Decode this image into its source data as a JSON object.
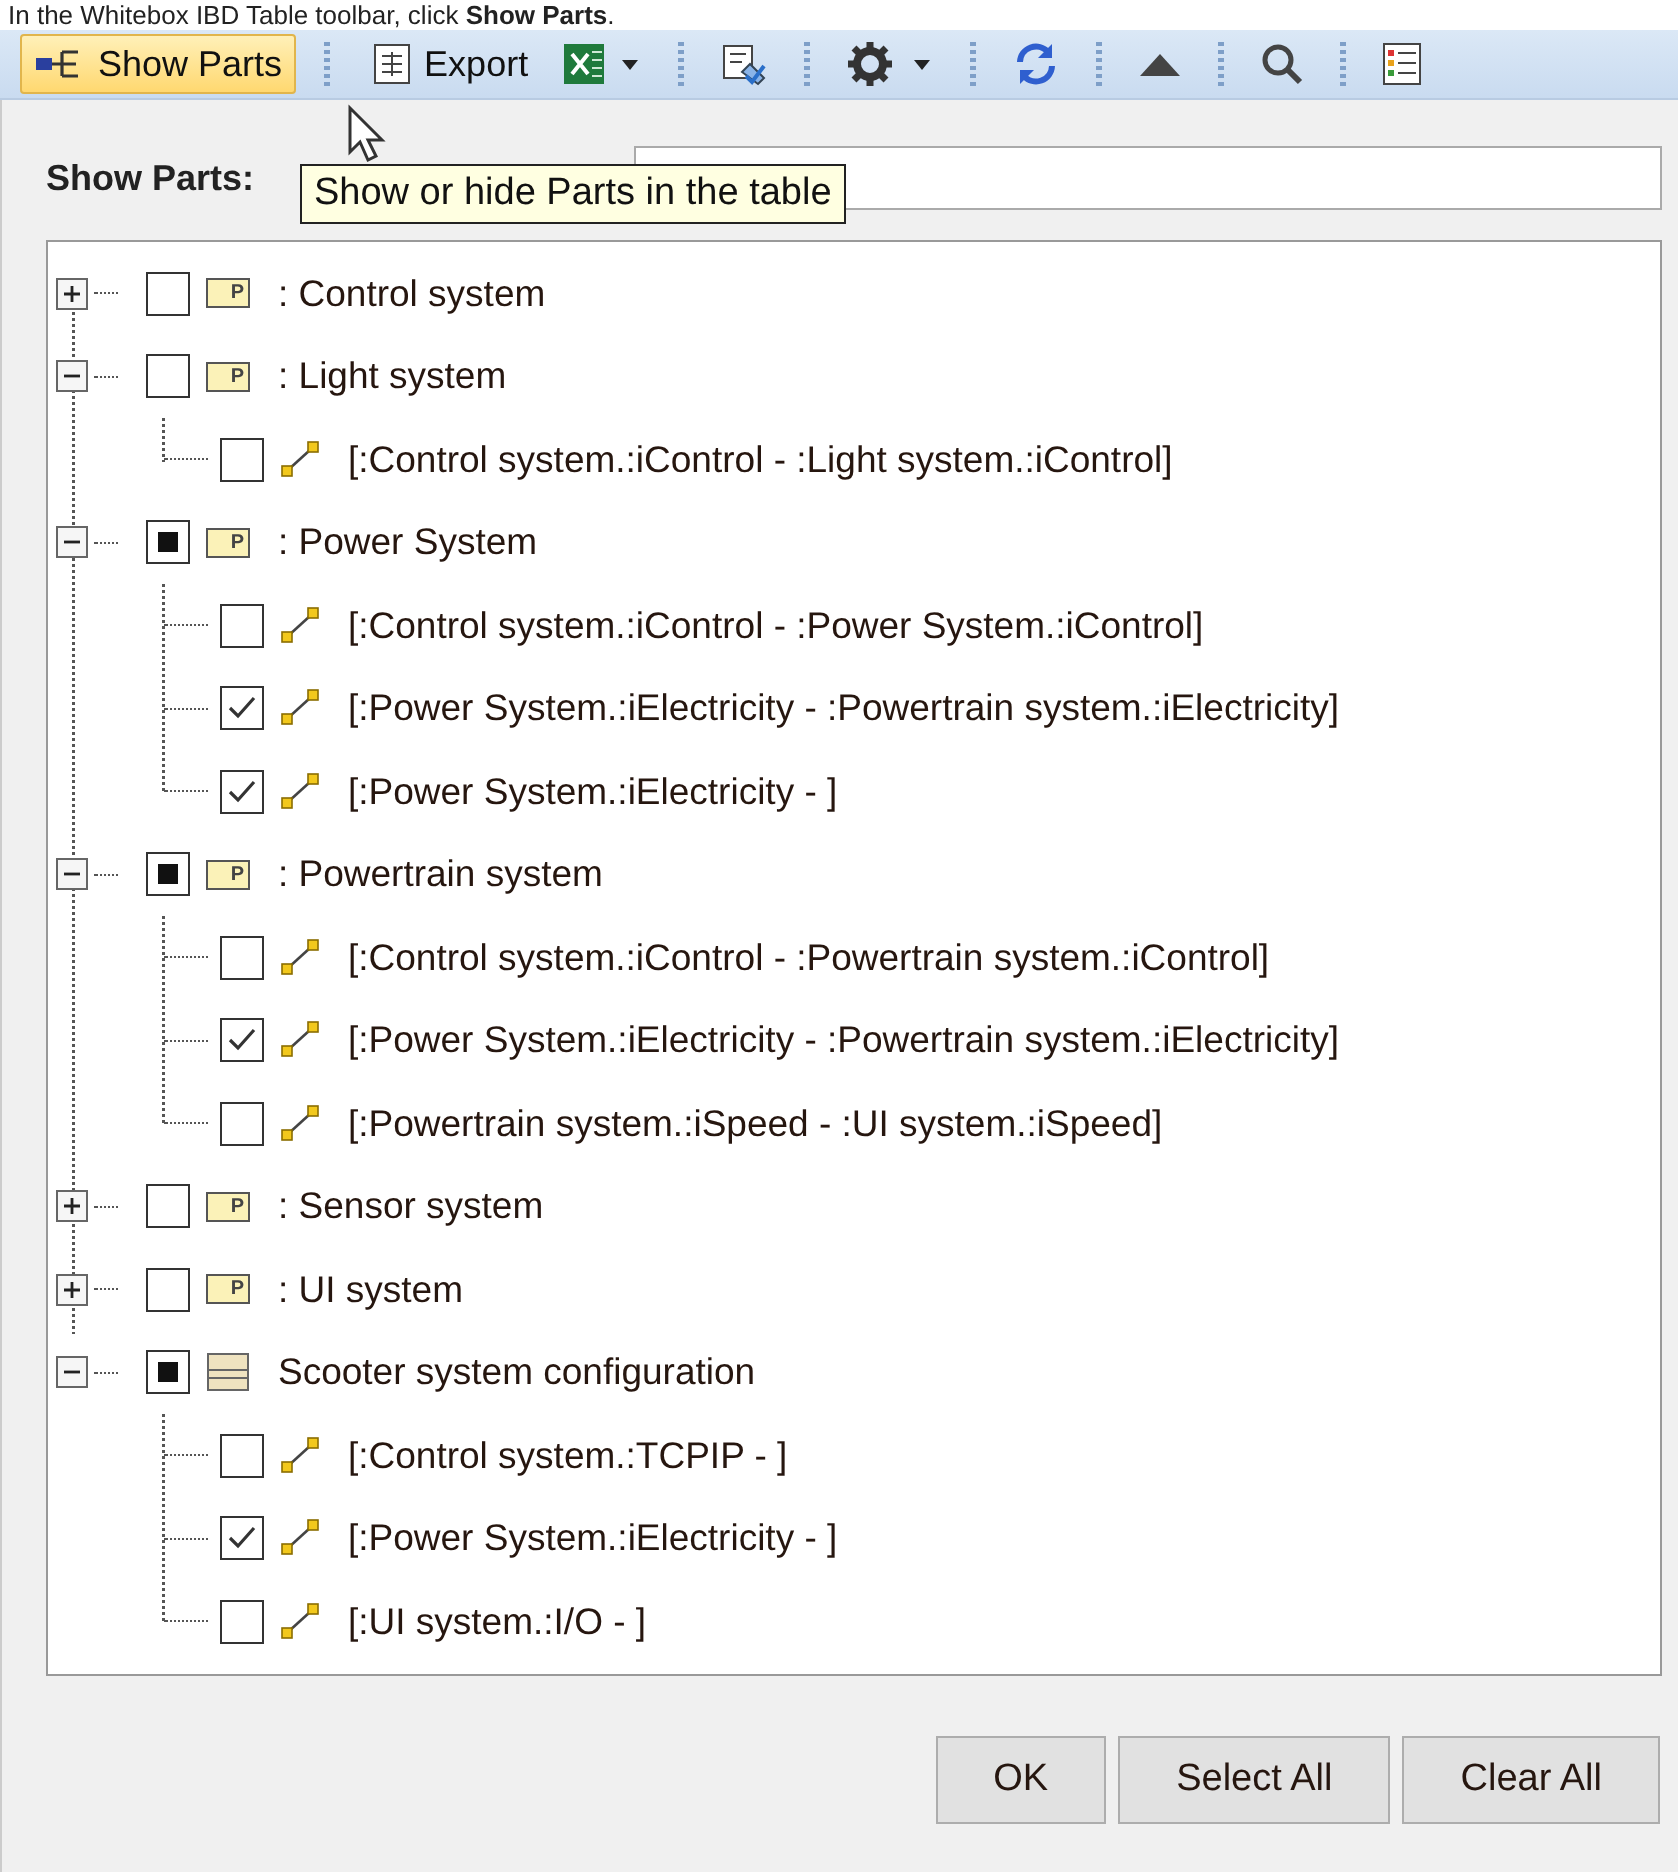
{
  "caption": "In the Whitebox IBD Table toolbar, click **Show Parts**.",
  "toolbar": {
    "show_parts": {
      "label": "Show Parts",
      "highlighted": true
    },
    "export": {
      "label": "Export"
    }
  },
  "dialog": {
    "field_label": "Show Parts:",
    "tooltip": "Show or hide Parts in the table",
    "tree": [
      {
        "kind": "part",
        "badge": "P",
        "label": ": Control system",
        "expanded": false,
        "mixed": false
      },
      {
        "kind": "part",
        "badge": "P",
        "label": ": Light system",
        "expanded": true,
        "mixed": false,
        "children": [
          {
            "label": "[:Control system.:iControl - :Light system.:iControl]",
            "checked": false
          }
        ]
      },
      {
        "kind": "part",
        "badge": "P",
        "label": ": Power System",
        "expanded": true,
        "mixed": true,
        "children": [
          {
            "label": "[:Control system.:iControl - :Power System.:iControl]",
            "checked": false
          },
          {
            "label": "[:Power System.:iElectricity - :Powertrain system.:iElectricity]",
            "checked": true
          },
          {
            "label": "[:Power System.:iElectricity - ]",
            "checked": true
          }
        ]
      },
      {
        "kind": "part",
        "badge": "P",
        "label": ": Powertrain system",
        "expanded": true,
        "mixed": true,
        "children": [
          {
            "label": "[:Control system.:iControl - :Powertrain system.:iControl]",
            "checked": false
          },
          {
            "label": "[:Power System.:iElectricity - :Powertrain system.:iElectricity]",
            "checked": true
          },
          {
            "label": "[:Powertrain system.:iSpeed - :UI system.:iSpeed]",
            "checked": false
          }
        ]
      },
      {
        "kind": "part",
        "badge": "P",
        "label": ": Sensor system",
        "expanded": false,
        "mixed": false
      },
      {
        "kind": "part",
        "badge": "P",
        "label": ": UI system",
        "expanded": false,
        "mixed": false
      },
      {
        "kind": "configuration",
        "label": "Scooter system configuration",
        "expanded": true,
        "mixed": true,
        "children": [
          {
            "label": "[:Control system.:TCPIP - ]",
            "checked": false
          },
          {
            "label": "[:Power System.:iElectricity - ]",
            "checked": true
          },
          {
            "label": "[:UI system.:I/O - ]",
            "checked": false
          }
        ]
      }
    ],
    "buttons": [
      "OK",
      "Select All",
      "Clear All"
    ]
  }
}
